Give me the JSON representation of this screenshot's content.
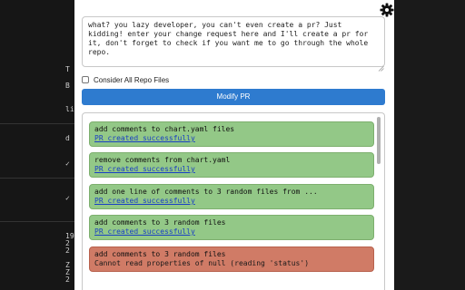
{
  "background": {
    "left_fragments": [
      "T",
      "B",
      "li",
      "d",
      "✓",
      "✓",
      "19",
      "2",
      "2",
      "Z",
      "Z",
      "2"
    ]
  },
  "popup": {
    "settings_icon": "gear-icon",
    "prompt_text": "what? you lazy developer, you can't even create a pr? Just kidding! enter your change request here and I'll create a pr for it, don't forget to check if you want me to go through the whole repo.",
    "checkbox_label": "Consider All Repo Files",
    "checkbox_checked": false,
    "modify_button_label": "Modify PR"
  },
  "results": [
    {
      "status": "success",
      "title": "add comments to chart.yaml files",
      "message": "PR created successfully"
    },
    {
      "status": "success",
      "title": "remove comments from chart.yaml",
      "message": "PR created successfully"
    },
    {
      "status": "success",
      "title": "add one line of comments to 3 random files from ...",
      "message": "PR created successfully"
    },
    {
      "status": "success",
      "title": "add comments to 3 random files",
      "message": "PR created successfully"
    },
    {
      "status": "error",
      "title": "add comments to 3 random files",
      "message": "Cannot read properties of null (reading 'status')"
    }
  ],
  "colors": {
    "success_bg": "#93c887",
    "error_bg": "#d07b66",
    "accent": "#2e7bcf",
    "link": "#1a3fc4"
  }
}
